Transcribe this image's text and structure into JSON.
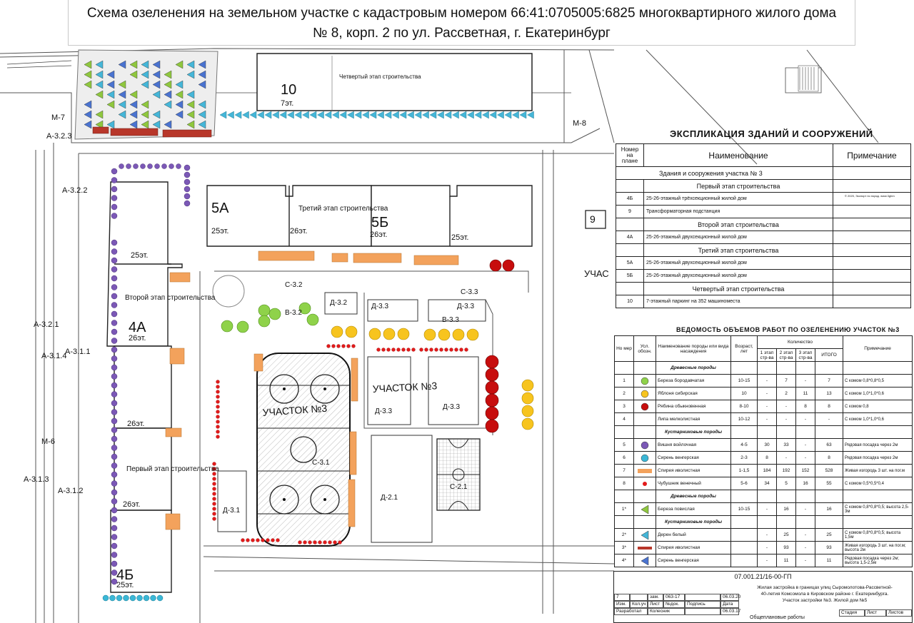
{
  "title": {
    "line1": "Схема озеленения на земельном участке с кадастровым номером 66:41:0705005:6825 многоквартирного жилого дома",
    "line2": "№ 8, корп. 2 по ул. Рассветная, г. Екатеринбург"
  },
  "plan": {
    "buildings": [
      {
        "num": "10",
        "floors": "7эт.",
        "stage": "Четвертый этап строительства"
      },
      {
        "num": "5А",
        "floors": "25эт."
      },
      {
        "num": "5Б",
        "floors": "26эт.",
        "floors2": "25эт."
      },
      {
        "stage": "Третий этап строительства",
        "floors": "26эт."
      },
      {
        "stage": "Второй этап строительства",
        "num": "4А",
        "floors": "26эт.",
        "floors2": "25эт."
      },
      {
        "floors": "26эт."
      },
      {
        "stage": "Первый этап строительства",
        "floors": "26эт."
      },
      {
        "num": "4Б",
        "floors": "25эт."
      }
    ],
    "uchastok_label": "УЧАСТОК №3",
    "uchastok_label2": "УЧАСТОК №3",
    "uchast_edge": "УЧАС",
    "lot_nine": "9",
    "zones": [
      "С-3.2",
      "В-3.2",
      "Д-3.2",
      "С-3.3",
      "Д-3.3",
      "В-3.3",
      "Д-3.3",
      "Д-3.3",
      "Д-3.3",
      "С-3.1",
      "Д-3.1",
      "С-2.1",
      "Д-2.1"
    ],
    "side_labels": [
      "М-7",
      "А-3.2.3",
      "А-3.2.2",
      "А-3.2.1",
      "А-3.1.4",
      "А-3.1.1",
      "М-6",
      "А-3.1.3",
      "А-3.1.2",
      "М-8"
    ]
  },
  "explication": {
    "title": "ЭКСПЛИКАЦИЯ ЗДАНИЙ И СООРУЖЕНИЙ",
    "col_num": "Номер на плане",
    "col_name": "Наименование",
    "col_note": "Примечание",
    "section": "Здания и сооружения участка № 3",
    "copyright": "© 2020, Экспорт по поряд. www.3ghm",
    "rows": [
      {
        "type": "stage",
        "name": "Первый этап строительства"
      },
      {
        "num": "4Б",
        "name": "25-26-этажный трёхсекционный жилой дом"
      },
      {
        "num": "9",
        "name": "Трансформаторная подстанция"
      },
      {
        "type": "stage",
        "name": "Второй этап строительства"
      },
      {
        "num": "4А",
        "name": "25-26-этажный двухсекционный жилой дом"
      },
      {
        "type": "stage",
        "name": "Третий этап строительства"
      },
      {
        "num": "5А",
        "name": "25-26-этажный двухсекционный жилой дом"
      },
      {
        "num": "5Б",
        "name": "25-26-этажный двухсекционный жилой дом"
      },
      {
        "type": "stage",
        "name": "Четвертый этап строительства"
      },
      {
        "num": "10",
        "name": "7-этажный паркинг на 352 машиноместа"
      }
    ]
  },
  "volumes": {
    "title": "ВЕДОМОСТЬ ОБЪЕМОВ РАБОТ ПО ОЗЕЛЕНЕНИЮ УЧАСТОК №3",
    "headers": {
      "num": "Но мер",
      "sym": "Усл. обозн.",
      "name": "Наименование породы или вида насаждения",
      "age": "Возраст, лет",
      "qty": "Количество",
      "s1": "1 этап стр-ва",
      "s2": "2 этап стр-ва",
      "s3": "3 этап стр-ва",
      "total": "ИТОГО",
      "note": "Примечание"
    },
    "rows": [
      {
        "type": "section",
        "name": "Древесные породы"
      },
      {
        "num": "1",
        "sym": "circle",
        "color": "#8fd24a",
        "name": "Береза бородавчатая",
        "age": "10-15",
        "s1": "-",
        "s2": "7",
        "s3": "-",
        "total": "7",
        "note": "С комом 0,8*0,8*0,5"
      },
      {
        "num": "2",
        "sym": "circle",
        "color": "#f7c41e",
        "name": "Яблоня сибирская",
        "age": "10",
        "s1": "-",
        "s2": "2",
        "s3": "11",
        "total": "13",
        "note": "С комом 1,0*1,0*0,6"
      },
      {
        "num": "3",
        "sym": "circle",
        "color": "#c70d0d",
        "name": "Рябина обыкновенная",
        "age": "8-10",
        "s1": "-",
        "s2": "-",
        "s3": "8",
        "total": "8",
        "note": "С комом 0,8"
      },
      {
        "num": "4",
        "sym": "none",
        "color": "",
        "name": "Липа мелколистная",
        "age": "10-12",
        "s1": "-",
        "s2": "-",
        "s3": "-",
        "total": "-",
        "note": "С комом 1,0*1,0*0,6"
      },
      {
        "type": "section",
        "name": "Кустарниковые породы"
      },
      {
        "num": "5",
        "sym": "circle",
        "color": "#7b58b6",
        "name": "Вишня войлочная",
        "age": "4-5",
        "s1": "30",
        "s2": "33",
        "s3": "-",
        "total": "63",
        "note": "Рядовая посадка через 2м"
      },
      {
        "num": "6",
        "sym": "circle",
        "color": "#3bb7d6",
        "name": "Сирень венгерская",
        "age": "2-3",
        "s1": "8",
        "s2": "-",
        "s3": "-",
        "total": "8",
        "note": "Рядовая посадка через 2м"
      },
      {
        "num": "7",
        "sym": "bar",
        "color": "#f3a25c",
        "name": "Спирея иволистная",
        "age": "1-1,5",
        "s1": "184",
        "s2": "192",
        "s3": "152",
        "total": "528",
        "note": "Живая изгородь 3 шт. на пог.м"
      },
      {
        "num": "8",
        "sym": "dot",
        "color": "#e21b1b",
        "name": "Чубушник венечный",
        "age": "5-6",
        "s1": "34",
        "s2": "5",
        "s3": "16",
        "total": "55",
        "note": "С комом 0,5*0,5*0,4"
      },
      {
        "type": "section",
        "name": "Древесные породы"
      },
      {
        "num": "1*",
        "sym": "tri-left",
        "color": "#8fc73e",
        "name": "Береза повислая",
        "age": "10-15",
        "s1": "-",
        "s2": "16",
        "s3": "-",
        "total": "16",
        "note": "С комом 0,8*0,8*0,5; высота 2,5-3м"
      },
      {
        "type": "section",
        "name": "Кустарниковые породы"
      },
      {
        "num": "2*",
        "sym": "tri-left",
        "color": "#45b6d8",
        "name": "Дерен белый",
        "age": "",
        "s1": "-",
        "s2": "25",
        "s3": "-",
        "total": "25",
        "note": "С комом 0,8*0,8*0,5; высота 1,5м"
      },
      {
        "num": "3*",
        "sym": "redbar",
        "color": "#b8372a",
        "name": "Спирея иволистная",
        "age": "",
        "s1": "-",
        "s2": "93",
        "s3": "-",
        "total": "93",
        "note": "Живая изгородь 3 шт. на пог.м; высота 2м"
      },
      {
        "num": "4*",
        "sym": "tri-left",
        "color": "#4a73d0",
        "name": "Сирень венгерская",
        "age": "",
        "s1": "-",
        "s2": "11",
        "s3": "-",
        "total": "11",
        "note": "Рядовая посадка через 2м; высота 1,5-2,5м"
      }
    ]
  },
  "stamp": {
    "code": "07.001.21/16-00-ГП",
    "desc1": "Жилая застройка в границах улиц Сыромолотова-Рассветной-",
    "desc2": "40-летия Комсомола в Кировском районе г. Екатеринбурга.",
    "desc3": "Участок застройки №3. Жилой дом №5",
    "stage": "Стадия",
    "sheet": "Лист",
    "sheets": "Листов",
    "r1a": "7",
    "r1b": "зам.",
    "r1c": "063-17",
    "r1d": "06.03.20",
    "hdr1": "Изм.",
    "hdr2": "Кол.уч",
    "hdr3": "Лист",
    "hdr4": "№док.",
    "hdr5": "Подпись",
    "hdr6": "Дата",
    "dev": "Разработал",
    "dev_name": "Колесник",
    "dev_date": "06.03.17",
    "bottom": "Общеплановые работы"
  }
}
